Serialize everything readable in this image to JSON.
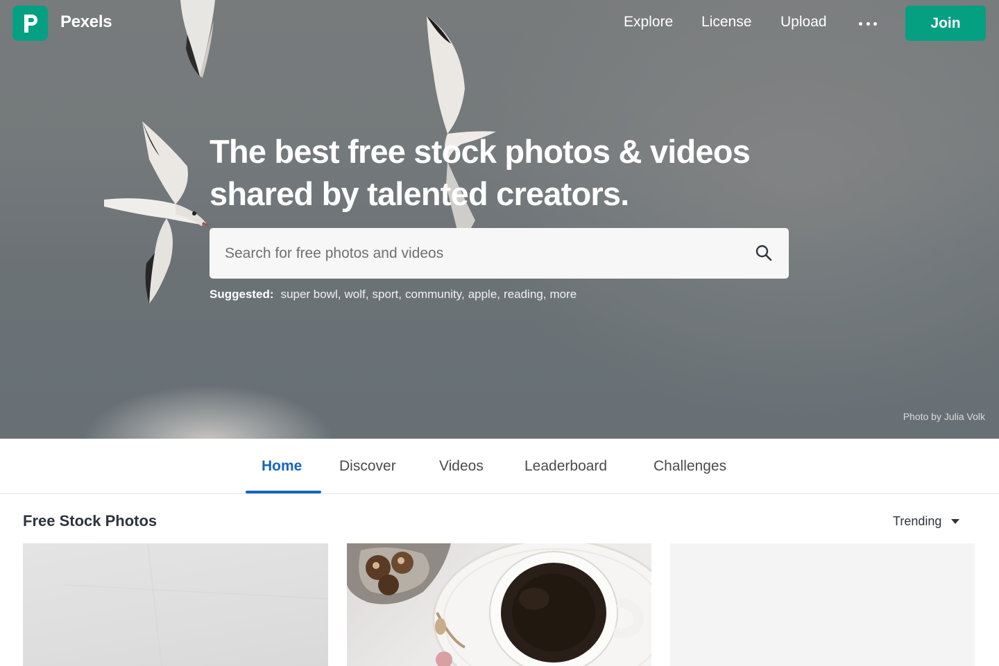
{
  "header": {
    "brand": "Pexels",
    "nav": [
      "Explore",
      "License",
      "Upload"
    ],
    "join_label": "Join"
  },
  "hero": {
    "headline_line1": "The best free stock photos & videos",
    "headline_line2": "shared by talented creators.",
    "search_placeholder": "Search for free photos and videos",
    "suggested_label": "Suggested:",
    "suggestions": [
      "super bowl",
      "wolf",
      "sport",
      "community",
      "apple",
      "reading",
      "more"
    ],
    "credit": "Photo by Julia Volk"
  },
  "tabs": [
    {
      "label": "Home",
      "active": true
    },
    {
      "label": "Discover",
      "active": false
    },
    {
      "label": "Videos",
      "active": false
    },
    {
      "label": "Leaderboard",
      "active": false
    },
    {
      "label": "Challenges",
      "active": false
    }
  ],
  "section": {
    "title": "Free Stock Photos",
    "sort_label": "Trending"
  },
  "icons": {
    "logo": "pexels-logo-icon",
    "more": "more-dots-icon",
    "search": "search-icon",
    "sort": "caret-down-icon"
  },
  "colors": {
    "brand": "#05a081",
    "active_tab": "#1565c0",
    "text": "#2c343e"
  }
}
